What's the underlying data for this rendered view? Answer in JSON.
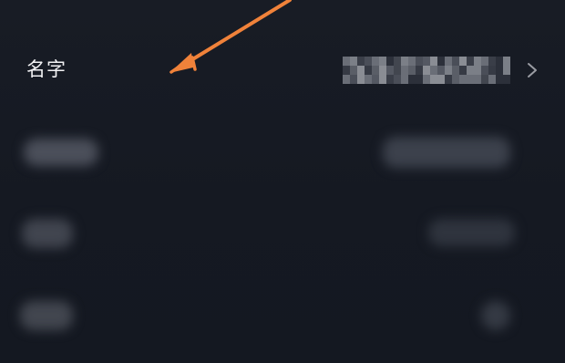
{
  "settings": {
    "name_row": {
      "label": "名字",
      "chevron_icon": "chevron-right-icon"
    }
  },
  "annotation": {
    "arrow_color": "#f0823a"
  },
  "colors": {
    "background": "#161a23",
    "label_text": "#f2f2f4",
    "chevron": "#9a9ca3"
  }
}
